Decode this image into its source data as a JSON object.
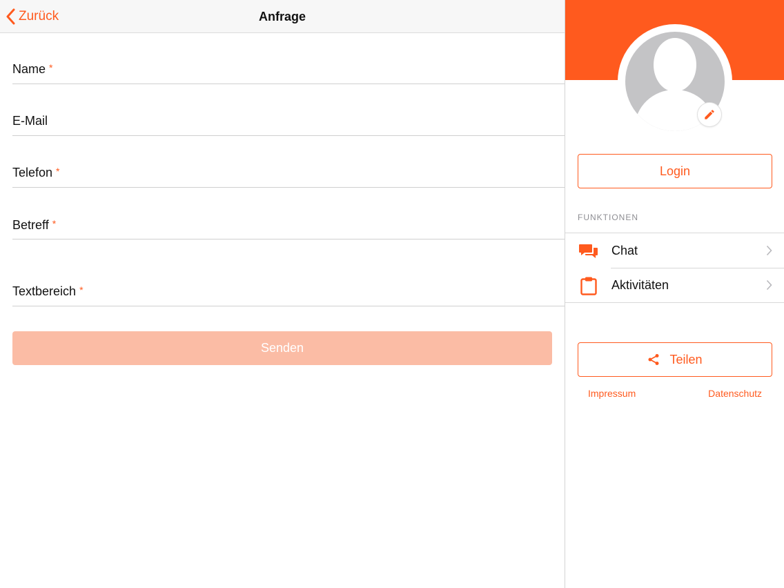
{
  "navbar": {
    "back_label": "Zurück",
    "title": "Anfrage"
  },
  "form": {
    "fields": [
      {
        "label": "Name",
        "required_mark": "*",
        "value": ""
      },
      {
        "label": "E-Mail",
        "required_mark": "",
        "value": ""
      },
      {
        "label": "Telefon",
        "required_mark": "*",
        "value": ""
      },
      {
        "label": "Betreff",
        "required_mark": "*",
        "value": ""
      },
      {
        "label": "Textbereich",
        "required_mark": "*",
        "value": ""
      }
    ],
    "submit_label": "Senden"
  },
  "sidebar": {
    "login_label": "Login",
    "section_title": "FUNKTIONEN",
    "menu": [
      {
        "label": "Chat",
        "icon": "chat-icon"
      },
      {
        "label": "Aktivitäten",
        "icon": "clipboard-icon"
      }
    ],
    "share_label": "Teilen",
    "links": {
      "impressum": "Impressum",
      "datenschutz": "Datenschutz"
    }
  },
  "colors": {
    "accent": "#ff5a1e",
    "button_disabled": "#fbbca5",
    "avatar_placeholder": "#c4c4c6"
  }
}
